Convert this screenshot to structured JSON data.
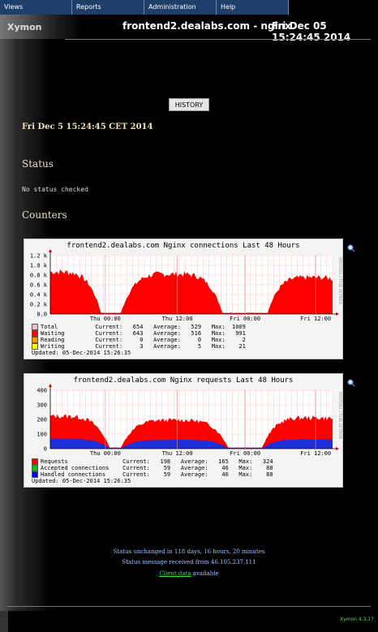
{
  "menu": {
    "items": [
      "Views",
      "Reports",
      "Administration",
      "Help"
    ]
  },
  "header": {
    "logo": "Xymon",
    "host": "frontend2.dealabs.com - nginx",
    "date": "Fri Dec 05 15:24:45 2014"
  },
  "history_button": "HISTORY",
  "status_date": "Fri Dec 5 15:24:45 CET 2014",
  "status_section": {
    "title": "Status",
    "text": "No status checked"
  },
  "counters_title": "Counters",
  "graph1": {
    "title": "frontend2.dealabs.com Nginx connections Last 48 Hours",
    "side_label": "RRDTOOL / TOBI OETIKER",
    "y_ticks": [
      "1.2 k",
      "1.0 k",
      "0.8 k",
      "0.6 k",
      "0.4 k",
      "0.2 k",
      "0.0"
    ],
    "x_ticks": [
      "Thu 00:00",
      "Thu 12:00",
      "Fri 00:00",
      "Fri 12:00"
    ],
    "legend": [
      {
        "name": "Total",
        "current": "654",
        "average": "529",
        "max": "1009",
        "color": "#eec6c6"
      },
      {
        "name": "Waiting",
        "current": "643",
        "average": "516",
        "max": "991",
        "color": "#ff0000"
      },
      {
        "name": "Reading",
        "current": "0",
        "average": "0",
        "max": "2",
        "color": "#ff9900"
      },
      {
        "name": "Writing",
        "current": "3",
        "average": "5",
        "max": "21",
        "color": "#ffff00"
      }
    ],
    "updated": "Updated: 05-Dec-2014 15:26:35"
  },
  "graph2": {
    "title": "frontend2.dealabs.com Nginx requests Last 48 Hours",
    "side_label": "RRDTOOL / TOBI OETIKER",
    "y_ticks": [
      "400",
      "300",
      "200",
      "100",
      "0"
    ],
    "x_ticks": [
      "Thu 00:00",
      "Thu 12:00",
      "Fri 00:00",
      "Fri 12:00"
    ],
    "legend": [
      {
        "name": "Requests",
        "current": "198",
        "average": "165",
        "max": "324",
        "color": "#ff0000"
      },
      {
        "name": "Accepted connections",
        "current": "59",
        "average": "46",
        "max": "88",
        "color": "#00cc00"
      },
      {
        "name": "Handled connections",
        "current": "59",
        "average": "46",
        "max": "88",
        "color": "#0000ff"
      }
    ],
    "updated": "Updated: 05-Dec-2014 15:26:35"
  },
  "footer": {
    "unchanged": "Status unchanged in 118 days, 16 hours, 20 minutes",
    "received": "Status message received from 46.105.237.111",
    "client_link": "Client data",
    "client_rest": " available"
  },
  "version": "Xymon 4.3.17",
  "colors": {
    "menu_bg": "#1f3f6b",
    "area_red": "#ff0000",
    "area_blue": "#1f2fd8",
    "footer_text": "#9fc2ff",
    "link_green": "#45e03f"
  }
}
